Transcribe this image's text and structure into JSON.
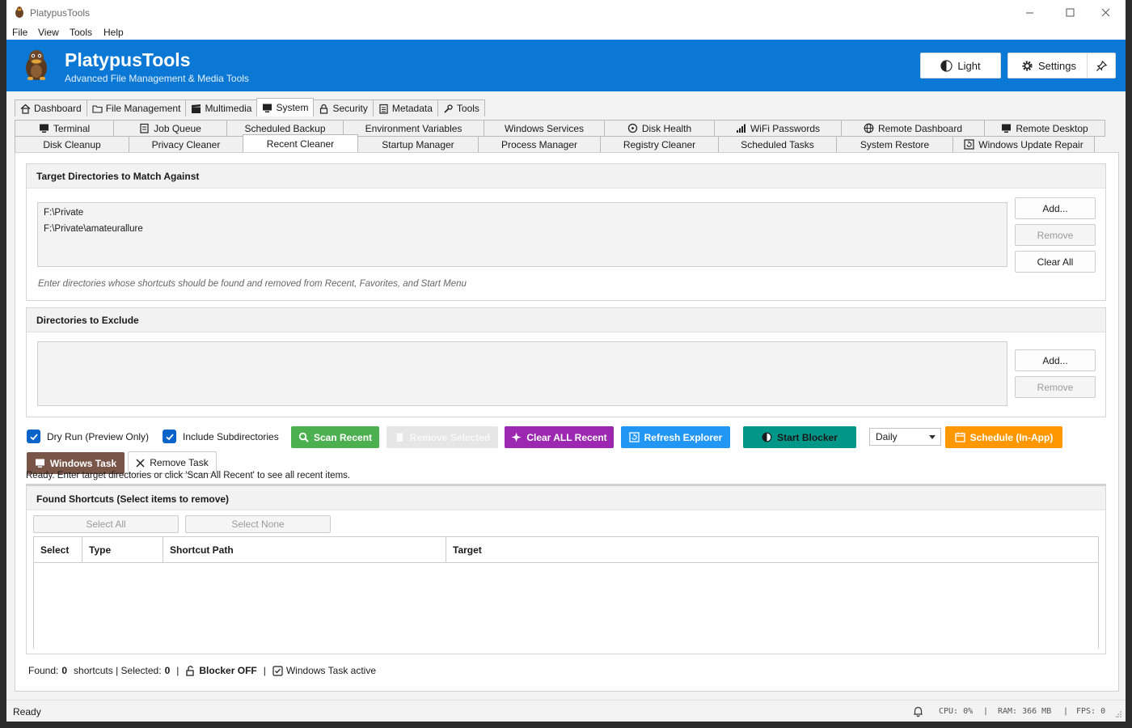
{
  "window": {
    "title": "PlatypusTools"
  },
  "menu": [
    "File",
    "View",
    "Tools",
    "Help"
  ],
  "header": {
    "app_name": "PlatypusTools",
    "subtitle": "Advanced File Management & Media Tools",
    "theme_label": "Light",
    "settings_label": "Settings",
    "accent": "#0a78d4"
  },
  "main_tabs": [
    "Dashboard",
    "File Management",
    "Multimedia",
    "System",
    "Security",
    "Metadata",
    "Tools"
  ],
  "sub_tabs_row1": [
    "Terminal",
    "Job Queue",
    "Scheduled Backup",
    "Environment Variables",
    "Windows Services",
    "Disk Health",
    "WiFi Passwords",
    "Remote Dashboard",
    "Remote Desktop"
  ],
  "sub_tabs_row2": [
    "Disk Cleanup",
    "Privacy Cleaner",
    "Recent Cleaner",
    "Startup Manager",
    "Process Manager",
    "Registry Cleaner",
    "Scheduled Tasks",
    "System Restore",
    "Windows Update Repair"
  ],
  "target": {
    "title": "Target Directories to Match Against",
    "items": [
      "F:\\Private",
      "F:\\Private\\amateurallure"
    ],
    "add_label": "Add...",
    "remove_label": "Remove",
    "clear_label": "Clear All",
    "hint": "Enter directories whose shortcuts should be found and removed from Recent, Favorites, and Start Menu"
  },
  "exclude": {
    "title": "Directories to Exclude",
    "add_label": "Add...",
    "remove_label": "Remove"
  },
  "actions": {
    "dry_run_label": "Dry Run (Preview Only)",
    "include_sub_label": "Include Subdirectories",
    "scan_label": "Scan Recent",
    "remove_selected_label": "Remove Selected",
    "clear_all_label": "Clear ALL Recent",
    "refresh_label": "Refresh Explorer",
    "blocker_label": "Start Blocker",
    "frequency": "Daily",
    "schedule_label": "Schedule (In-App)",
    "windows_task_label": "Windows Task",
    "remove_task_label": "Remove Task",
    "colors": {
      "scan": "#4caf50",
      "clear": "#9c27b0",
      "refresh": "#2196f3",
      "blocker": "#009688",
      "schedule": "#ff9800",
      "windows_task": "#795548"
    }
  },
  "status_message": "Ready. Enter target directories or click 'Scan All Recent' to see all recent items.",
  "found": {
    "title": "Found Shortcuts (Select items to remove)",
    "select_all": "Select All",
    "select_none": "Select None",
    "columns": [
      "Select",
      "Type",
      "Shortcut Path",
      "Target"
    ]
  },
  "footer": {
    "found_label": "Found:",
    "found_count": "0",
    "shortcuts_label": "shortcuts | Selected:",
    "selected_count": "0",
    "sep": "|",
    "blocker_state": "Blocker OFF",
    "task_state": "Windows Task active"
  },
  "statusbar": {
    "ready": "Ready",
    "cpu": "CPU: 0%",
    "ram": "RAM: 366 MB",
    "fps": "FPS: 0",
    "sep": "|"
  }
}
